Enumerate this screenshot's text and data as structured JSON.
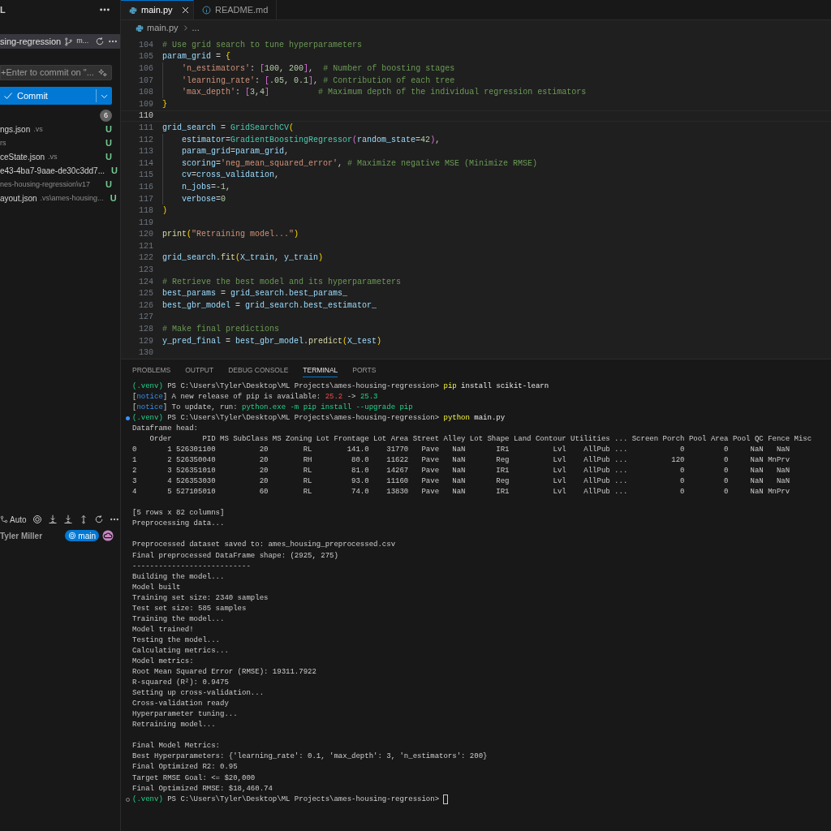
{
  "sidebar": {
    "title": "L",
    "branch_row": {
      "repo": "sing-regression",
      "branch": "m..."
    },
    "commit_box": {
      "placeholder": "+Enter to commit on \"..."
    },
    "commit_button": {
      "label": "Commit"
    },
    "changes_count": "6",
    "files": [
      {
        "name": "ngs.json",
        "detail": ".vs",
        "status": "U"
      },
      {
        "detail": "rs",
        "status": "U"
      },
      {
        "name": "ceState.json",
        "detail": ".vs",
        "status": "U"
      },
      {
        "name": "e43-4ba7-9aae-de30c3dd7...",
        "status": "U"
      },
      {
        "detail": "nes-housing-regression\\v17",
        "status": "U"
      },
      {
        "name": "ayout.json",
        "detail": ".vs\\ames-housing...",
        "status": "U"
      }
    ],
    "graph": {
      "toolbar_label": "Auto",
      "author": "Tyler Miller",
      "branch": "main"
    }
  },
  "editor": {
    "tabs": [
      {
        "label": "main.py",
        "selected": true,
        "kind": "python"
      },
      {
        "label": "README.md",
        "selected": false,
        "kind": "info"
      }
    ],
    "breadcrumb": [
      "main.py",
      "..."
    ],
    "lines": [
      {
        "no": "104",
        "tokens": [
          {
            "text": "# Use grid search to tune hyperparameters",
            "kind": "comment"
          }
        ]
      },
      {
        "no": "105",
        "tokens": [
          {
            "text": "param_grid",
            "kind": "var"
          },
          {
            "text": " = ",
            "kind": "op"
          },
          {
            "text": "{",
            "kind": "b1"
          }
        ],
        "children": [
          {
            "no": "106",
            "tokens": [
              {
                "text": "'n_estimators'",
                "kind": "str"
              },
              {
                "text": ": ",
                "kind": "op"
              },
              {
                "text": "[",
                "kind": "b2"
              },
              {
                "text": "100",
                "kind": "num"
              },
              {
                "text": ", ",
                "kind": "op"
              },
              {
                "text": "200",
                "kind": "num"
              },
              {
                "text": "]",
                "kind": "b2"
              },
              {
                "text": ",  ",
                "kind": "op"
              },
              {
                "text": "# Number of boosting stages",
                "kind": "comment"
              }
            ]
          },
          {
            "no": "107",
            "tokens": [
              {
                "text": "'learning_rate'",
                "kind": "str"
              },
              {
                "text": ": ",
                "kind": "op"
              },
              {
                "text": "[",
                "kind": "b2"
              },
              {
                "text": ".05",
                "kind": "num"
              },
              {
                "text": ", ",
                "kind": "op"
              },
              {
                "text": "0.1",
                "kind": "num"
              },
              {
                "text": "]",
                "kind": "b2"
              },
              {
                "text": ", ",
                "kind": "op"
              },
              {
                "text": "# Contribution of each tree",
                "kind": "comment"
              }
            ]
          },
          {
            "no": "108",
            "tokens": [
              {
                "text": "'max_depth'",
                "kind": "str"
              },
              {
                "text": ": ",
                "kind": "op"
              },
              {
                "text": "[",
                "kind": "b2"
              },
              {
                "text": "3",
                "kind": "num"
              },
              {
                "text": ",",
                "kind": "op"
              },
              {
                "text": "4",
                "kind": "num"
              },
              {
                "text": "]",
                "kind": "b2"
              },
              {
                "text": "          # Maximum depth of the individual regression estimators",
                "kind": "comment"
              }
            ]
          }
        ]
      },
      {
        "no": "109",
        "tokens": [
          {
            "text": "}",
            "kind": "b1"
          }
        ]
      },
      {
        "no": "110",
        "current": true
      },
      {
        "no": "111",
        "tokens": [
          {
            "text": "grid_search",
            "kind": "var"
          },
          {
            "text": " = ",
            "kind": "op"
          },
          {
            "text": "GridSearchCV",
            "kind": "cls"
          },
          {
            "text": "(",
            "kind": "b1"
          }
        ],
        "children": [
          {
            "no": "112",
            "tokens": [
              {
                "text": "estimator",
                "kind": "var"
              },
              {
                "text": "=",
                "kind": "op"
              },
              {
                "text": "GradientBoostingRegressor",
                "kind": "cls"
              },
              {
                "text": "(",
                "kind": "b2"
              },
              {
                "text": "random_state",
                "kind": "var"
              },
              {
                "text": "=",
                "kind": "op"
              },
              {
                "text": "42",
                "kind": "num"
              },
              {
                "text": ")",
                "kind": "b2"
              },
              {
                "text": ",",
                "kind": "op"
              }
            ]
          },
          {
            "no": "113",
            "tokens": [
              {
                "text": "param_grid",
                "kind": "var"
              },
              {
                "text": "=",
                "kind": "op"
              },
              {
                "text": "param_grid",
                "kind": "var"
              },
              {
                "text": ",",
                "kind": "op"
              }
            ]
          },
          {
            "no": "114",
            "tokens": [
              {
                "text": "scoring",
                "kind": "var"
              },
              {
                "text": "=",
                "kind": "op"
              },
              {
                "text": "'neg_mean_squared_error'",
                "kind": "str"
              },
              {
                "text": ", ",
                "kind": "op"
              },
              {
                "text": "# Maximize negative MSE (Minimize RMSE)",
                "kind": "comment"
              }
            ]
          },
          {
            "no": "115",
            "tokens": [
              {
                "text": "cv",
                "kind": "var"
              },
              {
                "text": "=",
                "kind": "op"
              },
              {
                "text": "cross_validation",
                "kind": "var"
              },
              {
                "text": ",",
                "kind": "op"
              }
            ]
          },
          {
            "no": "116",
            "tokens": [
              {
                "text": "n_jobs",
                "kind": "var"
              },
              {
                "text": "=",
                "kind": "op"
              },
              {
                "text": "-1",
                "kind": "num"
              },
              {
                "text": ",",
                "kind": "op"
              }
            ]
          },
          {
            "no": "117",
            "tokens": [
              {
                "text": "verbose",
                "kind": "var"
              },
              {
                "text": "=",
                "kind": "op"
              },
              {
                "text": "0",
                "kind": "num"
              }
            ]
          }
        ]
      },
      {
        "no": "118",
        "tokens": [
          {
            "text": ")",
            "kind": "b1"
          }
        ]
      },
      {
        "no": "119"
      },
      {
        "no": "120",
        "tokens": [
          {
            "text": "print",
            "kind": "fn"
          },
          {
            "text": "(",
            "kind": "b1"
          },
          {
            "text": "\"Retraining model...\"",
            "kind": "str"
          },
          {
            "text": ")",
            "kind": "b1"
          }
        ]
      },
      {
        "no": "121"
      },
      {
        "no": "122",
        "tokens": [
          {
            "text": "grid_search",
            "kind": "var"
          },
          {
            "text": ".",
            "kind": "op"
          },
          {
            "text": "fit",
            "kind": "fn"
          },
          {
            "text": "(",
            "kind": "b1"
          },
          {
            "text": "X_train",
            "kind": "var"
          },
          {
            "text": ", ",
            "kind": "op"
          },
          {
            "text": "y_train",
            "kind": "var"
          },
          {
            "text": ")",
            "kind": "b1"
          }
        ]
      },
      {
        "no": "123"
      },
      {
        "no": "124",
        "tokens": [
          {
            "text": "# Retrieve the best model and its hyperparameters",
            "kind": "comment"
          }
        ]
      },
      {
        "no": "125",
        "tokens": [
          {
            "text": "best_params",
            "kind": "var"
          },
          {
            "text": " = ",
            "kind": "op"
          },
          {
            "text": "grid_search",
            "kind": "var"
          },
          {
            "text": ".",
            "kind": "op"
          },
          {
            "text": "best_params_",
            "kind": "var"
          }
        ]
      },
      {
        "no": "126",
        "tokens": [
          {
            "text": "best_gbr_model",
            "kind": "var"
          },
          {
            "text": " = ",
            "kind": "op"
          },
          {
            "text": "grid_search",
            "kind": "var"
          },
          {
            "text": ".",
            "kind": "op"
          },
          {
            "text": "best_estimator_",
            "kind": "var"
          }
        ]
      },
      {
        "no": "127"
      },
      {
        "no": "128",
        "tokens": [
          {
            "text": "# Make final predictions",
            "kind": "comment"
          }
        ]
      },
      {
        "no": "129",
        "tokens": [
          {
            "text": "y_pred_final",
            "kind": "var"
          },
          {
            "text": " = ",
            "kind": "op"
          },
          {
            "text": "best_gbr_model",
            "kind": "var"
          },
          {
            "text": ".",
            "kind": "op"
          },
          {
            "text": "predict",
            "kind": "fn"
          },
          {
            "text": "(",
            "kind": "b1"
          },
          {
            "text": "X_test",
            "kind": "var"
          },
          {
            "text": ")",
            "kind": "b1"
          }
        ]
      },
      {
        "no": "130"
      }
    ]
  },
  "panel": {
    "tabs": [
      {
        "label": "PROBLEMS",
        "selected": false
      },
      {
        "label": "OUTPUT",
        "selected": false
      },
      {
        "label": "DEBUG CONSOLE",
        "selected": false
      },
      {
        "label": "TERMINAL",
        "selected": true
      },
      {
        "label": "PORTS",
        "selected": false
      }
    ],
    "terminal": [
      {
        "kind": "prompt",
        "env": "(.venv)",
        "path": "PS C:\\Users\\Tyler\\Desktop\\ML Projects\\ames-housing-regression>",
        "program": "pip",
        "args": "install scikit-learn"
      },
      {
        "kind": "segments",
        "segments": [
          {
            "text": "[",
            "kind": "plain"
          },
          {
            "text": "notice",
            "kind": "blue"
          },
          {
            "text": "] A new release of pip is available: ",
            "kind": "plain"
          },
          {
            "text": "25.2",
            "kind": "red"
          },
          {
            "text": " -> ",
            "kind": "plain"
          },
          {
            "text": "25.3",
            "kind": "green"
          }
        ]
      },
      {
        "kind": "segments",
        "segments": [
          {
            "text": "[",
            "kind": "plain"
          },
          {
            "text": "notice",
            "kind": "blue"
          },
          {
            "text": "] To update, run: ",
            "kind": "plain"
          },
          {
            "text": "python.exe -m pip install --upgrade pip",
            "kind": "green"
          }
        ]
      },
      {
        "kind": "prompt",
        "succeeded": true,
        "env": "(.venv)",
        "path": "PS C:\\Users\\Tyler\\Desktop\\ML Projects\\ames-housing-regression>",
        "program": "python",
        "args": "main.py"
      },
      {
        "kind": "output",
        "text": "Dataframe head:"
      },
      {
        "kind": "table",
        "columns": [
          "Order",
          "PID",
          "MS SubClass",
          "MS Zoning",
          "Lot Frontage",
          "Lot Area",
          "Street",
          "Alley",
          "Lot Shape",
          "Land Contour",
          "Utilities",
          "...",
          "Screen Porch",
          "Pool Area",
          "Pool QC",
          "Fence",
          "Misc"
        ],
        "rows": [
          {
            "index": "0",
            "cells": [
              "1",
              "526301100",
              "20",
              "RL",
              "141.0",
              "31770",
              "Pave",
              "NaN",
              "IR1",
              "Lvl",
              "AllPub",
              "...",
              "0",
              "0",
              "NaN",
              "NaN"
            ]
          },
          {
            "index": "1",
            "cells": [
              "2",
              "526350040",
              "20",
              "RH",
              "80.0",
              "11622",
              "Pave",
              "NaN",
              "Reg",
              "Lvl",
              "AllPub",
              "...",
              "120",
              "0",
              "NaN",
              "MnPrv"
            ]
          },
          {
            "index": "2",
            "cells": [
              "3",
              "526351010",
              "20",
              "RL",
              "81.0",
              "14267",
              "Pave",
              "NaN",
              "IR1",
              "Lvl",
              "AllPub",
              "...",
              "0",
              "0",
              "NaN",
              "NaN"
            ]
          },
          {
            "index": "3",
            "cells": [
              "4",
              "526353030",
              "20",
              "RL",
              "93.0",
              "11160",
              "Pave",
              "NaN",
              "Reg",
              "Lvl",
              "AllPub",
              "...",
              "0",
              "0",
              "NaN",
              "NaN"
            ]
          },
          {
            "index": "4",
            "cells": [
              "5",
              "527105010",
              "60",
              "RL",
              "74.0",
              "13830",
              "Pave",
              "NaN",
              "IR1",
              "Lvl",
              "AllPub",
              "...",
              "0",
              "0",
              "NaN",
              "MnPrv"
            ]
          }
        ]
      },
      {
        "kind": "output",
        "gap_before": true,
        "text": "[5 rows x 82 columns]"
      },
      {
        "kind": "output",
        "text": "Preprocessing data..."
      },
      {
        "kind": "output",
        "gap_before": true,
        "text": "Preprocessed dataset saved to: ames_housing_preprocessed.csv"
      },
      {
        "kind": "output",
        "text": "Final preprocessed DataFrame shape: (2925, 275)"
      },
      {
        "kind": "output",
        "text": "---------------------------"
      },
      {
        "kind": "output",
        "text": "Building the model..."
      },
      {
        "kind": "output",
        "text": "Model built"
      },
      {
        "kind": "output",
        "text": "Training set size: 2340 samples"
      },
      {
        "kind": "output",
        "text": "Test set size: 585 samples"
      },
      {
        "kind": "output",
        "text": "Training the model..."
      },
      {
        "kind": "output",
        "text": "Model trained!"
      },
      {
        "kind": "output",
        "text": "Testing the model..."
      },
      {
        "kind": "output",
        "text": "Calculating metrics..."
      },
      {
        "kind": "output",
        "text": "Model metrics:"
      },
      {
        "kind": "output",
        "text": "Root Mean Squared Error (RMSE): 19311.7922"
      },
      {
        "kind": "output",
        "text": "R-squared (R²): 0.9475"
      },
      {
        "kind": "output",
        "text": "Setting up cross-validation..."
      },
      {
        "kind": "output",
        "text": "Cross-validation ready"
      },
      {
        "kind": "output",
        "text": "Hyperparameter tuning..."
      },
      {
        "kind": "output",
        "text": "Retraining model..."
      },
      {
        "kind": "output",
        "gap_before": true,
        "text": "Final Model Metrics:"
      },
      {
        "kind": "output",
        "text": "Best Hyperparameters: {'learning_rate': 0.1, 'max_depth': 3, 'n_estimators': 200}"
      },
      {
        "kind": "output",
        "text": "Final Optimized R2: 0.95"
      },
      {
        "kind": "output",
        "text": "Target RMSE Goal: <= $20,000"
      },
      {
        "kind": "output",
        "text": "Final Optimized RMSE: $18,460.74"
      },
      {
        "kind": "prompt",
        "succeeded": false,
        "env": "(.venv)",
        "path": "PS C:\\Users\\Tyler\\Desktop\\ML Projects\\ames-housing-regression>",
        "cursor": true
      }
    ]
  }
}
